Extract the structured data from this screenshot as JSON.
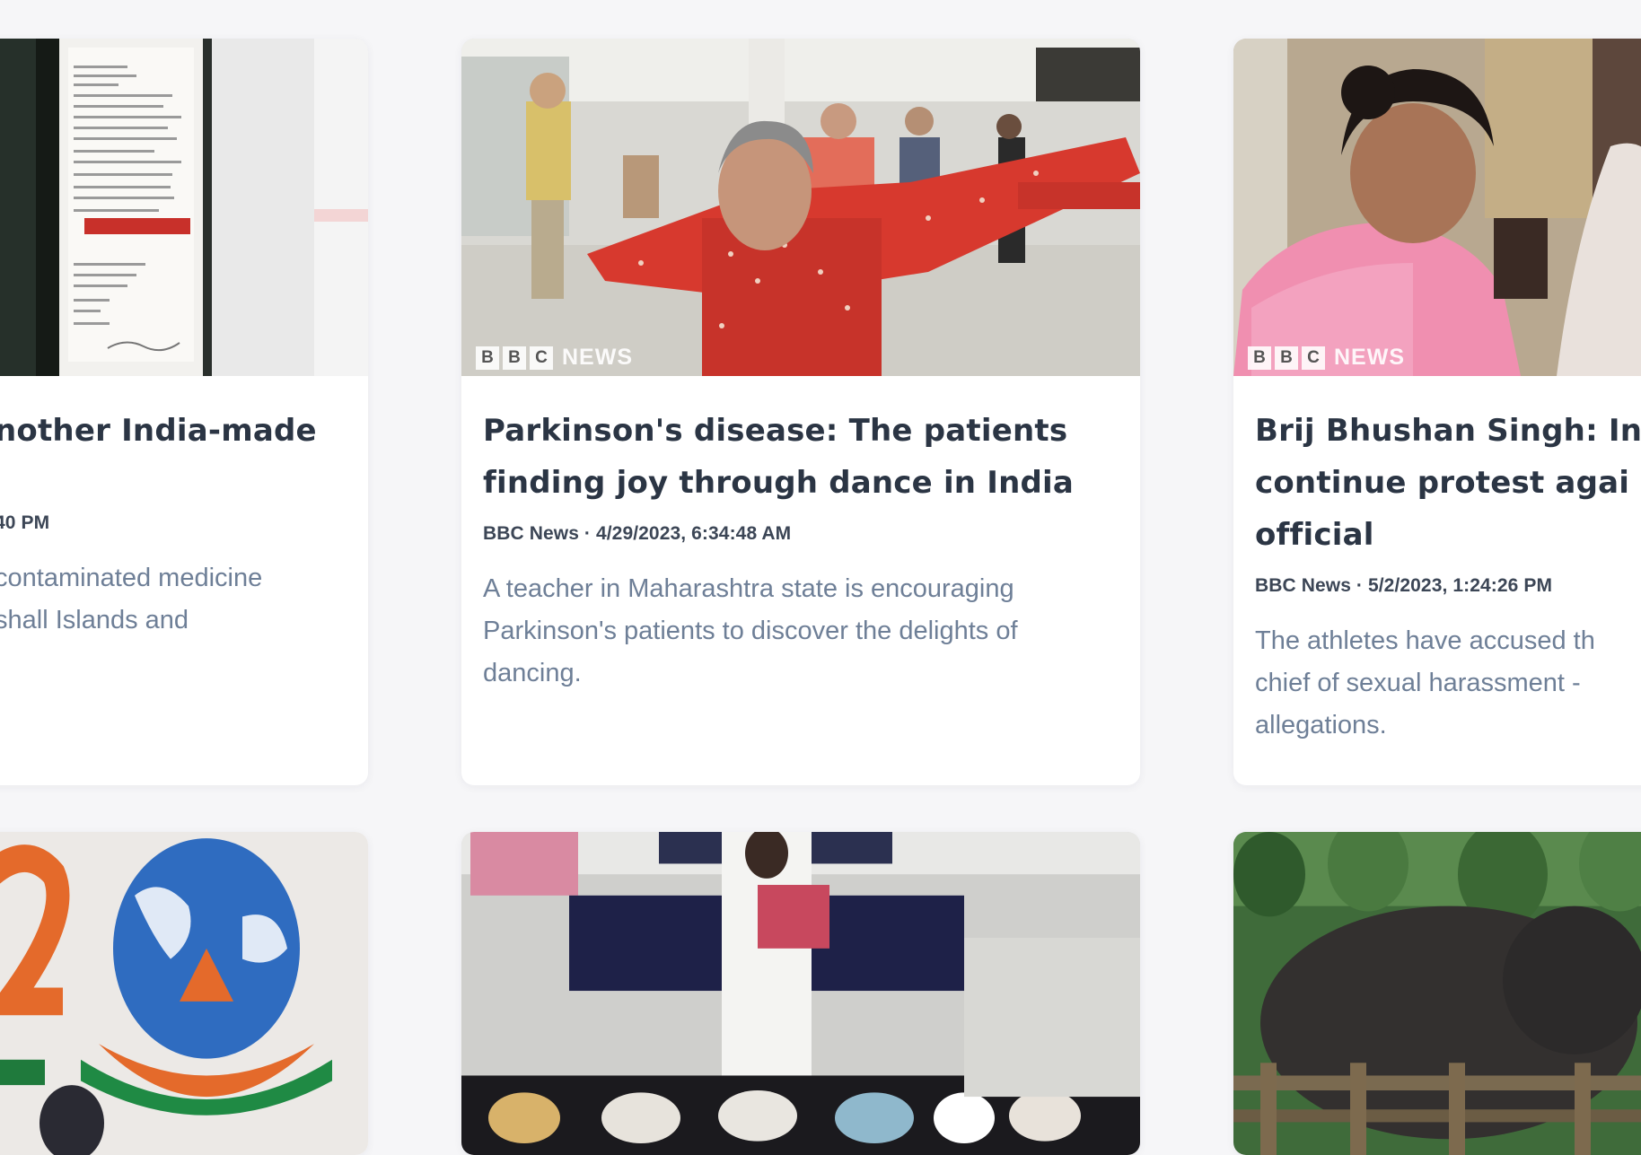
{
  "cards": [
    {
      "title": "…nother India-made",
      "meta": "…40 PM",
      "description": "… contaminated medicine … shall Islands and",
      "title_display": "nother India-made",
      "meta_display": "40 PM",
      "desc_display_1": "contaminated medicine",
      "desc_display_2": "shall Islands and"
    },
    {
      "title": "Parkinson's disease: The patients finding joy through dance in India",
      "meta": "BBC News · 4/29/2023, 6:34:48 AM",
      "description": "A teacher in Maharashtra state is encouraging Parkinson's patients to discover the delights of dancing.",
      "watermark": "NEWS"
    },
    {
      "title_display": "Brij Bhushan Singh: Inc",
      "title_display_2": "continue protest agai",
      "title_display_3": "official",
      "meta": "BBC News · 5/2/2023, 1:24:26 PM",
      "desc_display_1": "The athletes have accused th",
      "desc_display_2": "chief of sexual harassment -",
      "desc_display_3": "allegations.",
      "watermark": "NEWS"
    }
  ],
  "colors": {
    "page_background": "#f6f6f8",
    "card_background": "#ffffff",
    "title": "#2b3544",
    "meta": "#3c4656",
    "description": "#6e7f97"
  }
}
